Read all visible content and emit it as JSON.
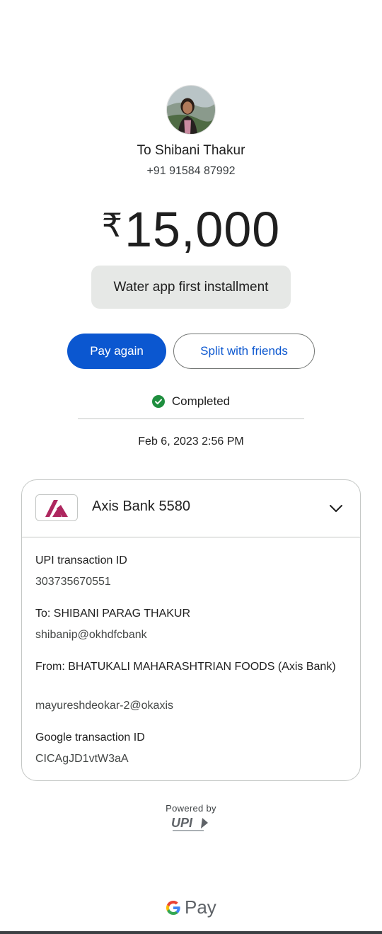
{
  "recipient": {
    "name": "To Shibani Thakur",
    "phone": "+91 91584 87992"
  },
  "payment": {
    "currency_symbol": "₹",
    "amount": "15,000",
    "note": "Water app first installment"
  },
  "actions": {
    "pay_again_label": "Pay again",
    "split_label": "Split with friends"
  },
  "status": {
    "text": "Completed",
    "datetime": "Feb 6, 2023 2:56 PM"
  },
  "account": {
    "bank_name": "Axis Bank 5580",
    "details": {
      "upi_id_label": "UPI transaction ID",
      "upi_id_value": "303735670551",
      "to_label": "To: SHIBANI PARAG THAKUR",
      "to_value": "shibanip@okhdfcbank",
      "from_label": "From: BHATUKALI MAHARASHTRIAN FOODS (Axis Bank)",
      "from_value": "mayureshdeokar-2@okaxis",
      "google_id_label": "Google transaction ID",
      "google_id_value": "CICAgJD1vtW3aA"
    }
  },
  "footer": {
    "powered_by": "Powered by",
    "upi_logo_text": "UPI",
    "gpay_text": "Pay"
  },
  "colors": {
    "primary": "#0b57d0",
    "success": "#1e8e3e",
    "axis_brand": "#ae275f"
  },
  "icons": [
    "avatar-photo",
    "check-circle-icon",
    "axis-bank-logo",
    "chevron-down-icon",
    "upi-logo",
    "google-g-icon"
  ]
}
